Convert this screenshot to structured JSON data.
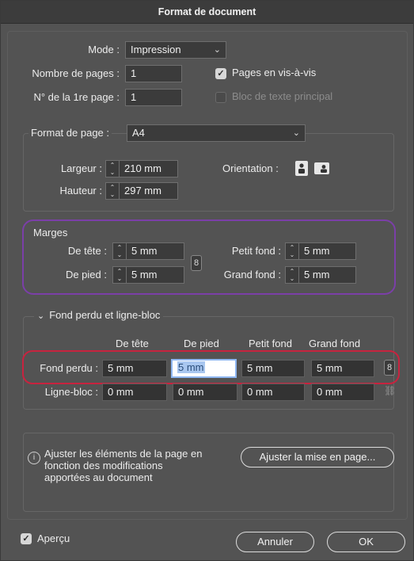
{
  "window": {
    "title": "Format de document"
  },
  "general": {
    "mode_label": "Mode :",
    "mode_value": "Impression",
    "pages_label": "Nombre de pages :",
    "pages_value": "1",
    "first_page_label": "N° de la 1re page :",
    "first_page_value": "1",
    "facing_pages_label": "Pages en vis-à-vis",
    "primary_text_frame_label": "Bloc de texte principal"
  },
  "page_size": {
    "label": "Format de page :",
    "value": "A4",
    "width_label": "Largeur :",
    "width_value": "210 mm",
    "height_label": "Hauteur :",
    "height_value": "297 mm",
    "orientation_label": "Orientation :"
  },
  "margins": {
    "title": "Marges",
    "top_label": "De tête :",
    "top_value": "5 mm",
    "bottom_label": "De pied :",
    "bottom_value": "5 mm",
    "inside_label": "Petit fond :",
    "inside_value": "5 mm",
    "outside_label": "Grand fond :",
    "outside_value": "5 mm"
  },
  "bleed": {
    "section_title": "Fond perdu et ligne-bloc",
    "columns": [
      "De tête",
      "De pied",
      "Petit fond",
      "Grand fond"
    ],
    "bleed_label": "Fond perdu :",
    "bleed_values": [
      "5 mm",
      "5 mm",
      "5 mm",
      "5 mm"
    ],
    "slug_label": "Ligne-bloc :",
    "slug_values": [
      "0 mm",
      "0 mm",
      "0 mm",
      "0 mm"
    ]
  },
  "info": {
    "text_line1": "Ajuster les éléments de la page en",
    "text_line2": "fonction des modifications",
    "text_line3": "apportées au document",
    "adjust_button": "Ajuster la mise en page..."
  },
  "footer": {
    "preview_label": "Aperçu",
    "cancel_button": "Annuler",
    "ok_button": "OK"
  }
}
